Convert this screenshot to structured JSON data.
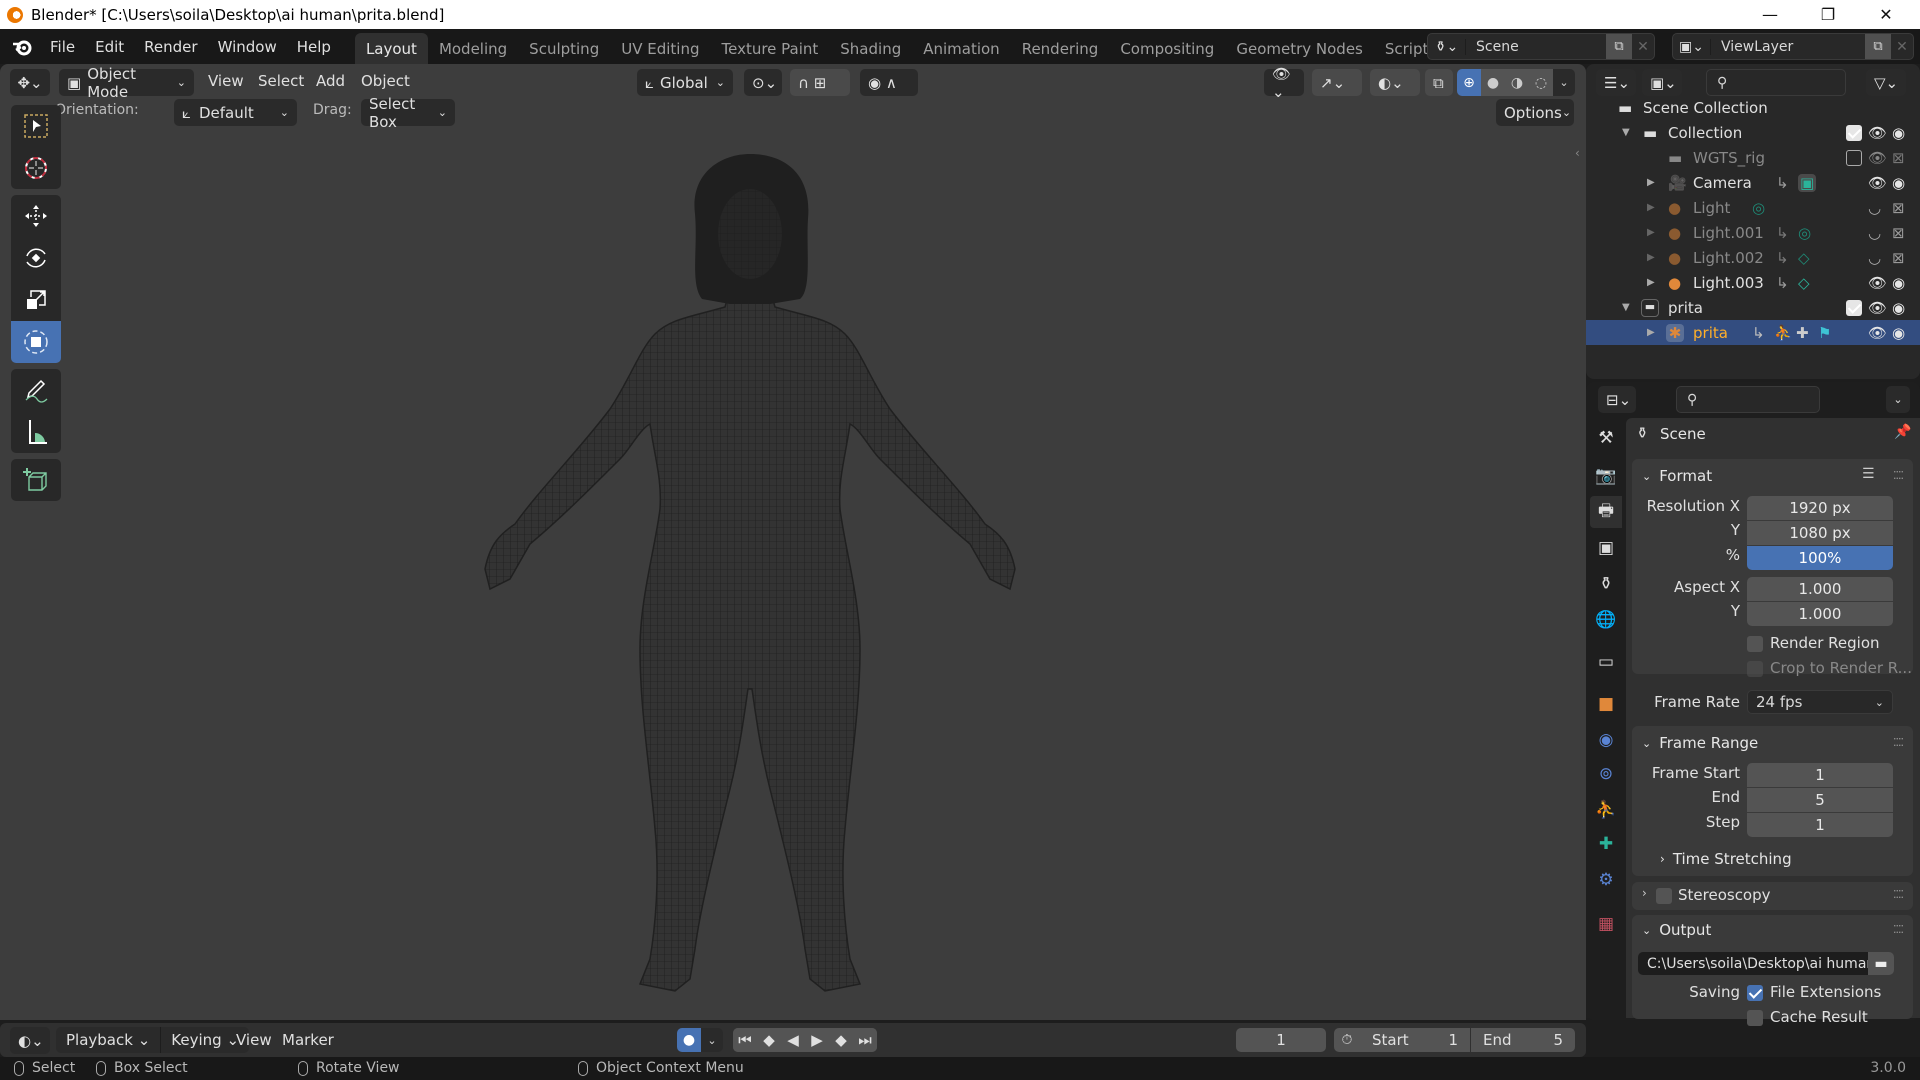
{
  "window": {
    "title": "Blender* [C:\\Users\\soila\\Desktop\\ai human\\prita.blend]",
    "minimize": "—",
    "maximize": "❐",
    "close": "✕"
  },
  "topbar": {
    "menus": [
      "File",
      "Edit",
      "Render",
      "Window",
      "Help"
    ],
    "workspaces": [
      "Layout",
      "Modeling",
      "Sculpting",
      "UV Editing",
      "Texture Paint",
      "Shading",
      "Animation",
      "Rendering",
      "Compositing",
      "Geometry Nodes",
      "Scripting"
    ],
    "active_workspace": "Layout",
    "add_workspace": "+",
    "scene": "Scene",
    "view_layer": "ViewLayer"
  },
  "viewport": {
    "mode": "Object Mode",
    "menus": [
      "View",
      "Select",
      "Add",
      "Object"
    ],
    "transform_orientation": "Global",
    "orientation_label": "Orientation:",
    "orientation_value": "Default",
    "drag_label": "Drag:",
    "drag_value": "Select Box",
    "options": "Options",
    "shading_active": "wireframe",
    "tools": [
      "select-box",
      "cursor",
      "move",
      "rotate",
      "scale",
      "transform",
      "annotate",
      "measure",
      "add-cube"
    ],
    "active_tool": "transform"
  },
  "outliner": {
    "root": "Scene Collection",
    "rows": [
      {
        "name": "Collection",
        "type": "collection",
        "depth": 0,
        "expanded": true,
        "checked": true,
        "visible": true,
        "renderable": true
      },
      {
        "name": "WGTS_rig",
        "type": "collection",
        "depth": 1,
        "checked": false,
        "visible": true,
        "renderable": false,
        "dimmed": true
      },
      {
        "name": "Camera",
        "type": "camera",
        "depth": 1,
        "visible": true,
        "renderable": true
      },
      {
        "name": "Light",
        "type": "light",
        "depth": 1,
        "visible": false,
        "renderable": false,
        "dimmed": true
      },
      {
        "name": "Light.001",
        "type": "light",
        "depth": 1,
        "visible": false,
        "renderable": false,
        "dimmed": true
      },
      {
        "name": "Light.002",
        "type": "light",
        "depth": 1,
        "visible": false,
        "renderable": false,
        "dimmed": true
      },
      {
        "name": "Light.003",
        "type": "light",
        "depth": 1,
        "visible": true,
        "renderable": true
      },
      {
        "name": "prita",
        "type": "collection",
        "depth": 0,
        "expanded": true,
        "checked": true,
        "visible": true,
        "renderable": true
      },
      {
        "name": "prita",
        "type": "armature",
        "depth": 1,
        "visible": true,
        "renderable": true,
        "selected": true
      }
    ]
  },
  "properties": {
    "context": "Scene",
    "format": {
      "title": "Format",
      "resolution_x_label": "Resolution X",
      "resolution_x": "1920 px",
      "resolution_y_label": "Y",
      "resolution_y": "1080 px",
      "percent_label": "%",
      "percent": "100%",
      "aspect_x_label": "Aspect X",
      "aspect_x": "1.000",
      "aspect_y_label": "Y",
      "aspect_y": "1.000",
      "render_region": "Render Region",
      "crop": "Crop to Render R...",
      "frame_rate_label": "Frame Rate",
      "frame_rate": "24 fps"
    },
    "frame_range": {
      "title": "Frame Range",
      "start_label": "Frame Start",
      "start": "1",
      "end_label": "End",
      "end": "5",
      "step_label": "Step",
      "step": "1",
      "time_stretching": "Time Stretching"
    },
    "stereoscopy": "Stereoscopy",
    "output": {
      "title": "Output",
      "path": "C:\\Users\\soila\\Desktop\\ai human\\",
      "saving_label": "Saving",
      "file_extensions": "File Extensions",
      "file_extensions_on": true,
      "cache_result": "Cache Result",
      "cache_result_on": false
    }
  },
  "timeline": {
    "menus": [
      "Playback",
      "Keying",
      "View",
      "Marker"
    ],
    "current_frame": "1",
    "start_label": "Start",
    "start": "1",
    "end_label": "End",
    "end": "5"
  },
  "statusbar": {
    "select": "Select",
    "box_select": "Box Select",
    "rotate_view": "Rotate View",
    "context_menu": "Object Context Menu",
    "version": "3.0.0"
  }
}
